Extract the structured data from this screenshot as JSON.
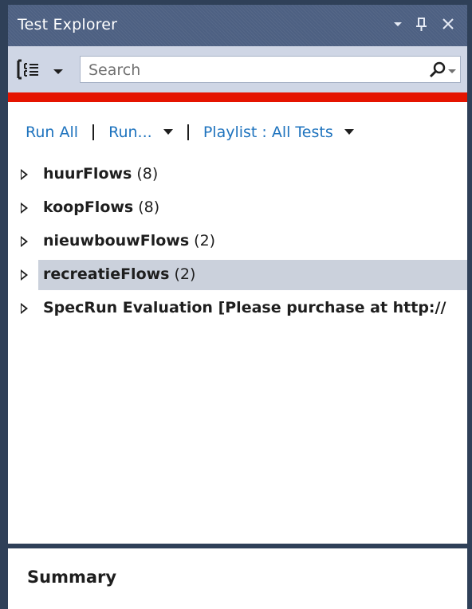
{
  "window": {
    "title": "Test Explorer",
    "dropdown_icon": "chevron-down-icon",
    "pin_icon": "pin-icon",
    "close_icon": "close-icon"
  },
  "toolbar": {
    "group_icon": "group-by-icon",
    "search_placeholder": "Search",
    "search_value": "",
    "search_icon": "search-icon"
  },
  "progress": {
    "status": "failed",
    "color": "#e51400",
    "fraction": 1.0
  },
  "actions": {
    "run_all": "Run All",
    "run": "Run...",
    "playlist": "Playlist : All Tests"
  },
  "tree": [
    {
      "name": "huurFlows",
      "count": "(8)",
      "selected": false
    },
    {
      "name": "koopFlows",
      "count": "(8)",
      "selected": false
    },
    {
      "name": "nieuwbouwFlows",
      "count": "(2)",
      "selected": false
    },
    {
      "name": "recreatieFlows",
      "count": "(2)",
      "selected": true
    },
    {
      "name": "SpecRun Evaluation [Please purchase at http://",
      "count": "",
      "selected": false
    }
  ],
  "summary": {
    "title": "Summary"
  },
  "colors": {
    "titlebar": "#4d6082",
    "toolbar": "#cfd6e5",
    "link": "#1e73be",
    "selection": "#cbd1dc",
    "frame": "#2f4058"
  }
}
